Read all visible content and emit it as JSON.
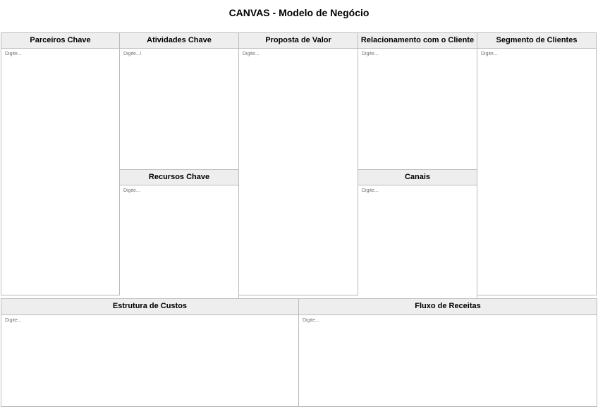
{
  "title": "CANVAS - Modelo de Negócio",
  "top": {
    "partners": {
      "header": "Parceiros Chave",
      "placeholder": "Digite..."
    },
    "activities": {
      "header": "Atividades Chave",
      "placeholder": "Digite...!"
    },
    "resources": {
      "header": "Recursos Chave",
      "placeholder": "Digite..."
    },
    "value": {
      "header": "Proposta de Valor",
      "placeholder": "Digite..."
    },
    "relation": {
      "header": "Relacionamento com o Cliente",
      "placeholder": "Digite..."
    },
    "channels": {
      "header": "Canais",
      "placeholder": "Digite..."
    },
    "segments": {
      "header": "Segmento de Clientes",
      "placeholder": "Digite..."
    }
  },
  "bottom": {
    "costs": {
      "header": "Estrutura de Custos",
      "placeholder": "Digite..."
    },
    "revenue": {
      "header": "Fluxo de Receitas",
      "placeholder": "Digite..."
    }
  }
}
